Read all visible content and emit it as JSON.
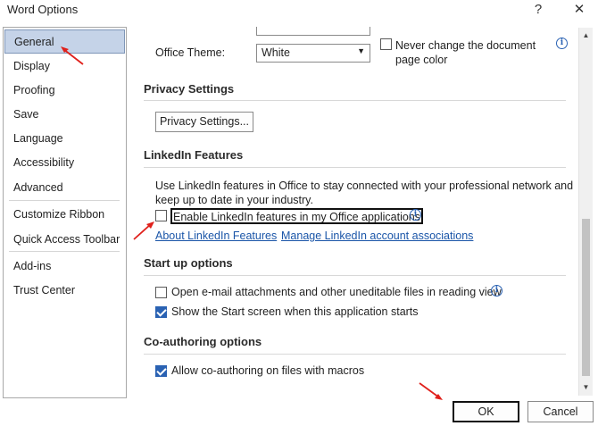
{
  "window": {
    "title": "Word Options",
    "help_label": "?",
    "close_label": "✕"
  },
  "nav": {
    "items": [
      {
        "label": "General",
        "selected": true
      },
      {
        "label": "Display"
      },
      {
        "label": "Proofing"
      },
      {
        "label": "Save"
      },
      {
        "label": "Language"
      },
      {
        "label": "Accessibility"
      },
      {
        "label": "Advanced"
      },
      {
        "label": "Customize Ribbon"
      },
      {
        "label": "Quick Access Toolbar"
      },
      {
        "label": "Add-ins"
      },
      {
        "label": "Trust Center"
      }
    ]
  },
  "theme": {
    "label": "Office Theme:",
    "value": "White",
    "never_change_label_line1": "Never change the document",
    "never_change_label_line2": "page color",
    "never_change_checked": false
  },
  "privacy": {
    "heading": "Privacy Settings",
    "button_label": "Privacy Settings..."
  },
  "linkedin": {
    "heading": "LinkedIn Features",
    "description_line1": "Use LinkedIn features in Office to stay connected with your professional network and",
    "description_line2": "keep up to date in your industry.",
    "enable_label": "Enable LinkedIn features in my Office applications",
    "enable_checked": false,
    "about_link": "About LinkedIn Features",
    "manage_link": "Manage LinkedIn account associations"
  },
  "startup": {
    "heading": "Start up options",
    "open_email_label": "Open e-mail attachments and other uneditable files in reading view",
    "open_email_checked": false,
    "show_start_label": "Show the Start screen when this application starts",
    "show_start_checked": true
  },
  "coauthoring": {
    "heading": "Co-authoring options",
    "allow_label": "Allow co-authoring on files with macros",
    "allow_checked": true
  },
  "footer": {
    "ok_label": "OK",
    "cancel_label": "Cancel"
  },
  "colors": {
    "accent": "#2a62b3",
    "selected_nav": "#c5d3e8",
    "annotation_arrow": "#e0201b"
  }
}
